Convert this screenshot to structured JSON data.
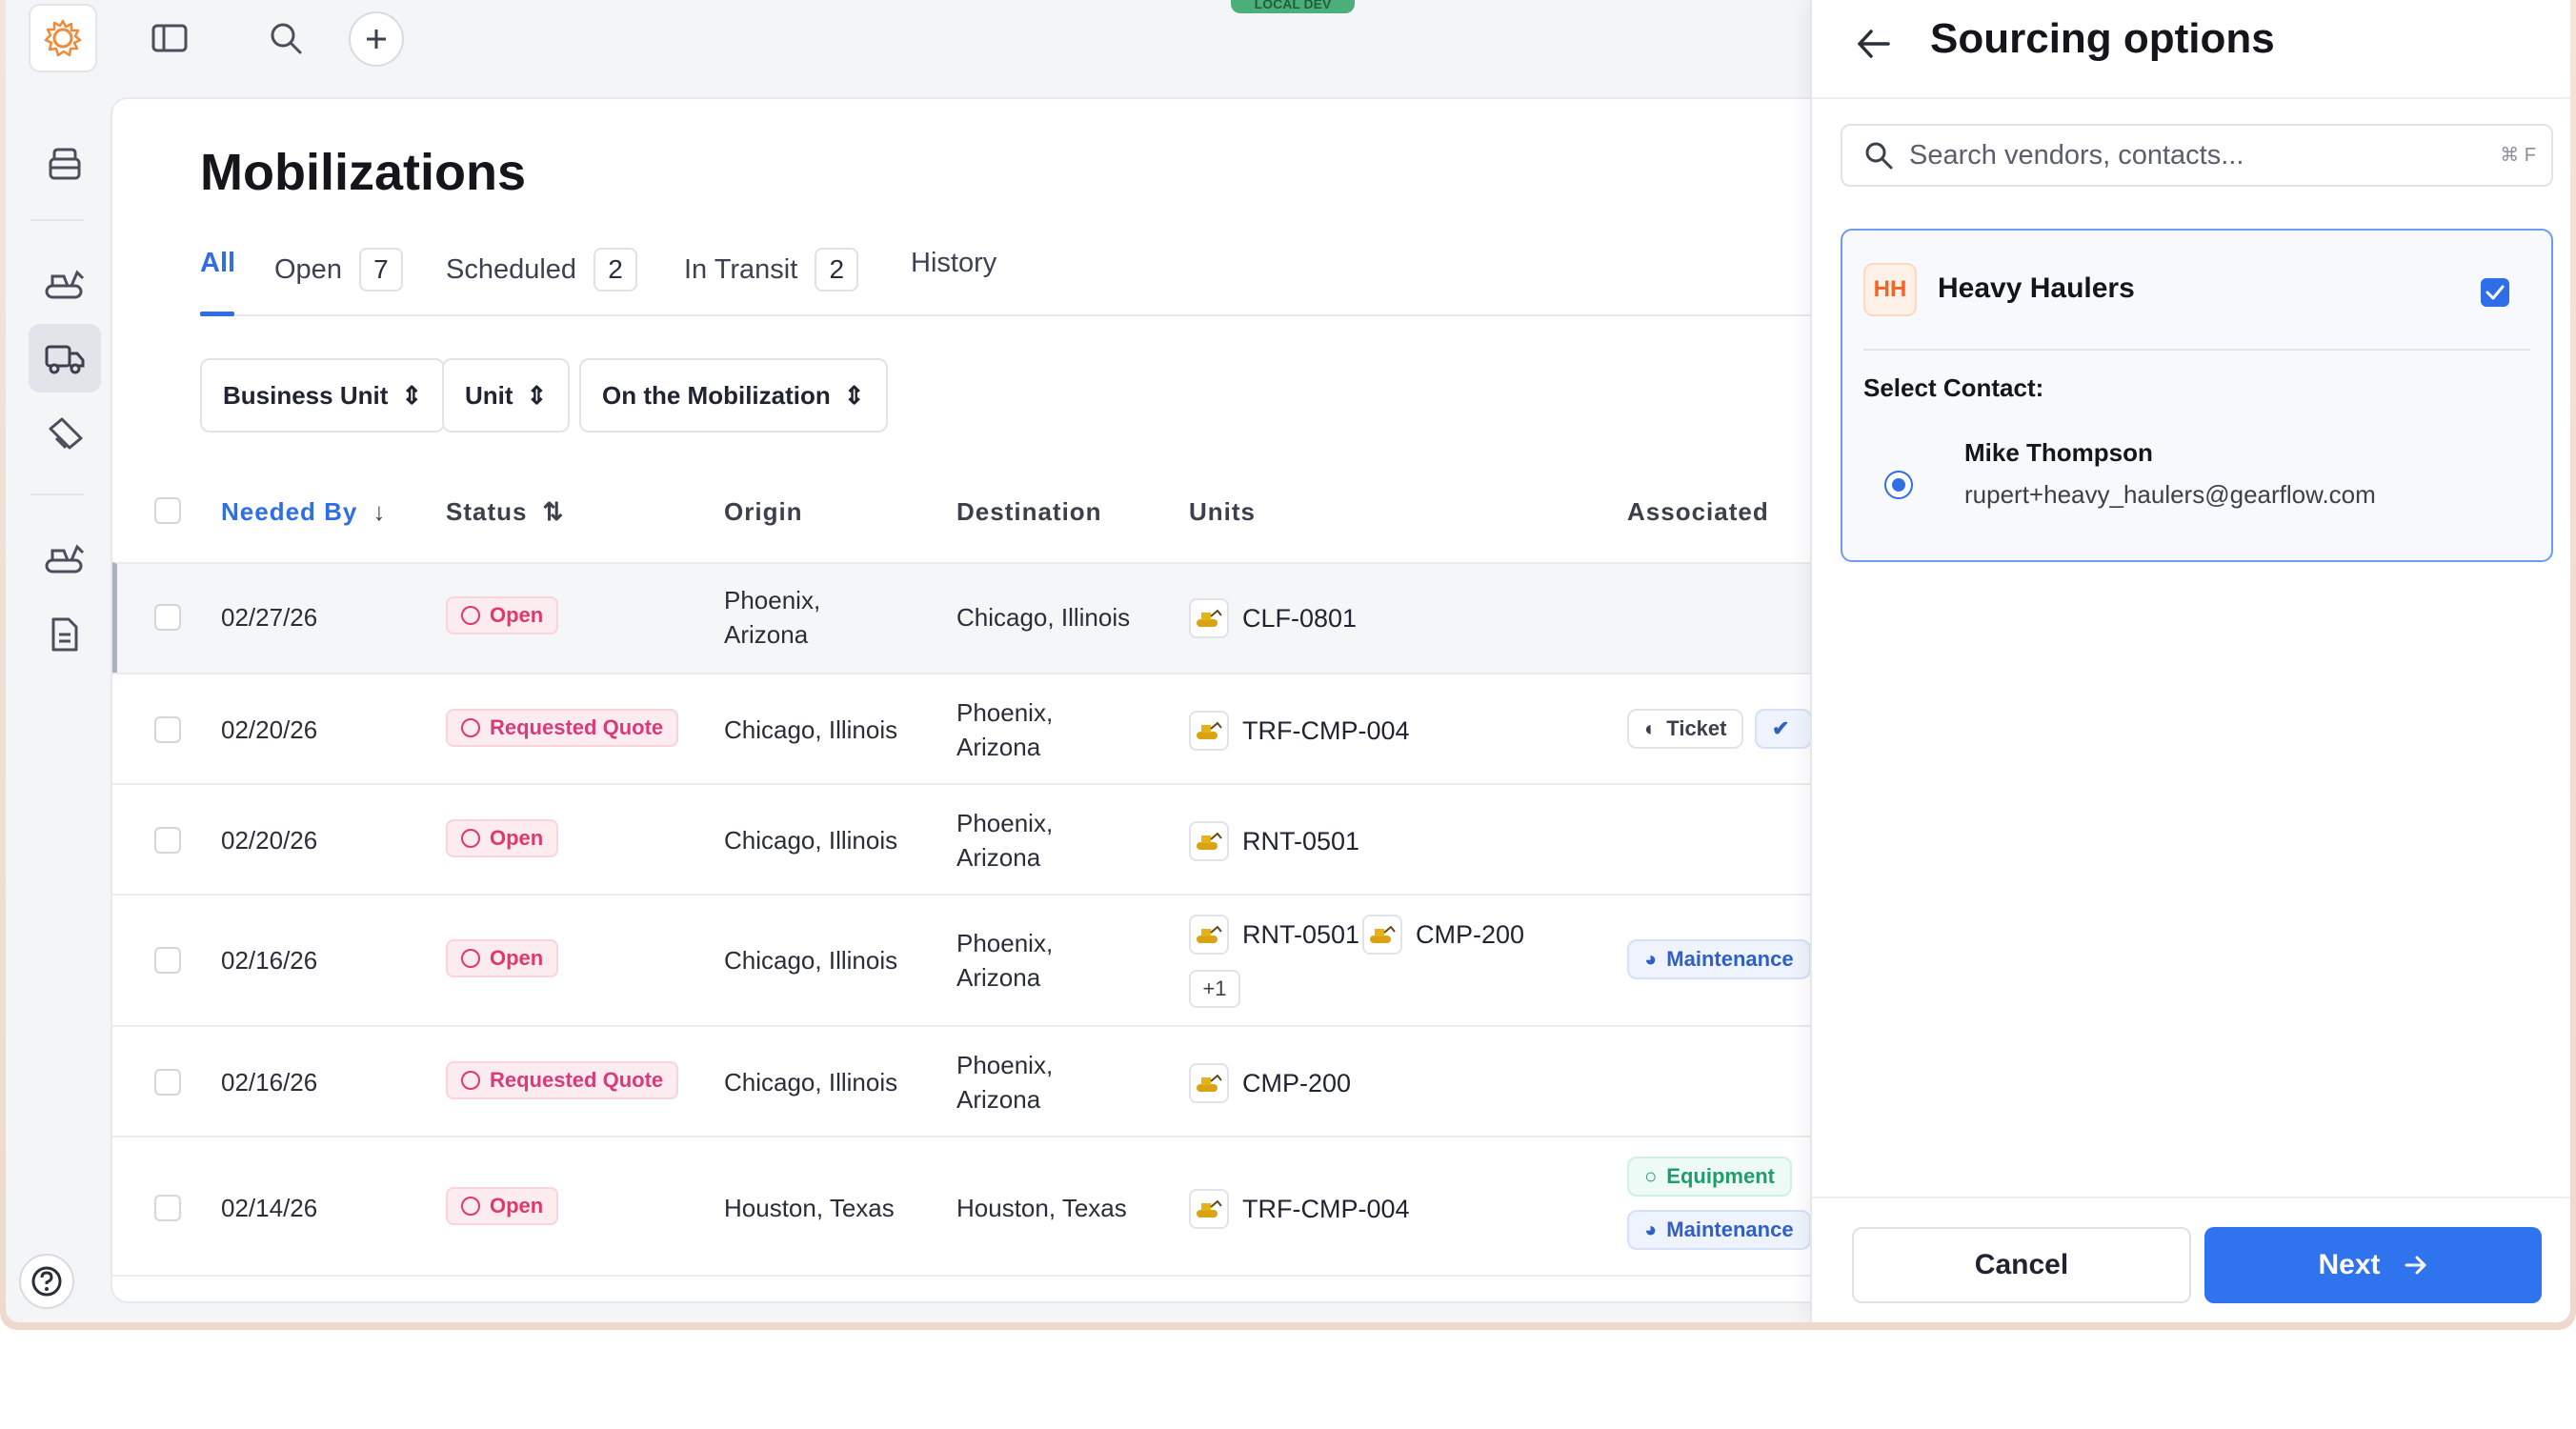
{
  "env_badge": "LOCAL DEV",
  "page": {
    "title": "Mobilizations",
    "tabs": [
      {
        "label": "All",
        "count": ""
      },
      {
        "label": "Open",
        "count": "7"
      },
      {
        "label": "Scheduled",
        "count": "2"
      },
      {
        "label": "In Transit",
        "count": "2"
      },
      {
        "label": "History",
        "count": ""
      }
    ],
    "filters": [
      "Business Unit",
      "Unit",
      "On the Mobilization"
    ],
    "columns": [
      "Needed By",
      "Status",
      "Origin",
      "Destination",
      "Units",
      "Associated"
    ],
    "rows": [
      {
        "needed_by": "02/27/26",
        "status": "Open",
        "origin": "Phoenix, Arizona",
        "destination": "Chicago, Illinois",
        "units": [
          "CLF-0801"
        ]
      },
      {
        "needed_by": "02/20/26",
        "status": "Requested Quote",
        "origin": "Chicago, Illinois",
        "destination": "Phoenix, Arizona",
        "units": [
          "TRF-CMP-004"
        ],
        "associated": [
          "Ticket"
        ]
      },
      {
        "needed_by": "02/20/26",
        "status": "Open",
        "origin": "Chicago, Illinois",
        "destination": "Phoenix, Arizona",
        "units": [
          "RNT-0501"
        ]
      },
      {
        "needed_by": "02/16/26",
        "status": "Open",
        "origin": "Chicago, Illinois",
        "destination": "Phoenix, Arizona",
        "units": [
          "RNT-0501",
          "CMP-200"
        ],
        "more": "+1",
        "associated": [
          "Maintenance"
        ]
      },
      {
        "needed_by": "02/16/26",
        "status": "Requested Quote",
        "origin": "Chicago, Illinois",
        "destination": "Phoenix, Arizona",
        "units": [
          "CMP-200"
        ]
      },
      {
        "needed_by": "02/14/26",
        "status": "Open",
        "origin": "Houston, Texas",
        "destination": "Houston, Texas",
        "units": [
          "TRF-CMP-004"
        ],
        "associated": [
          "Equipment",
          "Maintenance"
        ]
      }
    ]
  },
  "drawer": {
    "title": "Sourcing options",
    "search_placeholder": "Search vendors, contacts...",
    "search_shortcut": "⌘ F",
    "vendor": {
      "initials": "HH",
      "name": "Heavy Haulers",
      "checked": true,
      "select_contact_label": "Select Contact:",
      "contact_name": "Mike Thompson",
      "contact_email": "rupert+heavy_haulers@gearflow.com"
    },
    "cancel_label": "Cancel",
    "next_label": "Next"
  },
  "colors": {
    "accent": "#2f6ee6",
    "status_pink": "#e0386b",
    "vendor_orange": "#f0652a"
  }
}
